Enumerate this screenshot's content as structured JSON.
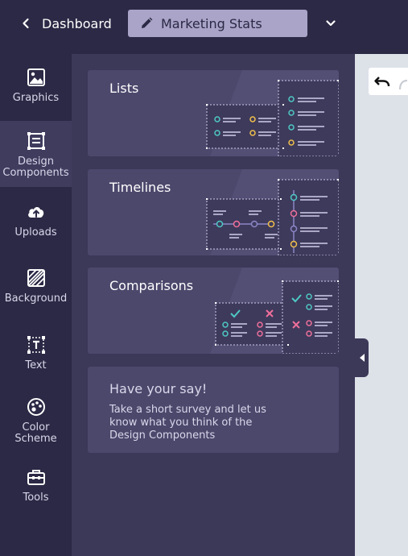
{
  "header": {
    "back_label": "Dashboard",
    "title": "Marketing Stats"
  },
  "rail": {
    "items": [
      {
        "label": "Graphics",
        "icon": "image-icon",
        "active": false
      },
      {
        "label": "Design\nComponents",
        "icon": "components-icon",
        "active": true
      },
      {
        "label": "Uploads",
        "icon": "cloud-upload-icon",
        "active": false
      },
      {
        "label": "Background",
        "icon": "background-pattern-icon",
        "active": false
      },
      {
        "label": "Text",
        "icon": "text-icon",
        "active": false
      },
      {
        "label": "Color\nScheme",
        "icon": "palette-icon",
        "active": false
      },
      {
        "label": "Tools",
        "icon": "toolbox-icon",
        "active": false
      }
    ]
  },
  "panel": {
    "cards": [
      {
        "title": "Lists"
      },
      {
        "title": "Timelines"
      },
      {
        "title": "Comparisons"
      }
    ],
    "survey": {
      "heading": "Have your say!",
      "body": "Take a short survey and let us\nknow what you think of the\nDesign Components"
    }
  },
  "colors": {
    "bg": "#2b2945",
    "panel": "#3b3858",
    "card": "#4c486c",
    "title_box": "#a9a4c8",
    "teal": "#4ec9c3",
    "yellow": "#f0c04a",
    "pink": "#ef6f9a",
    "purple": "#8b86c6",
    "canvas": "#dde1e8"
  }
}
